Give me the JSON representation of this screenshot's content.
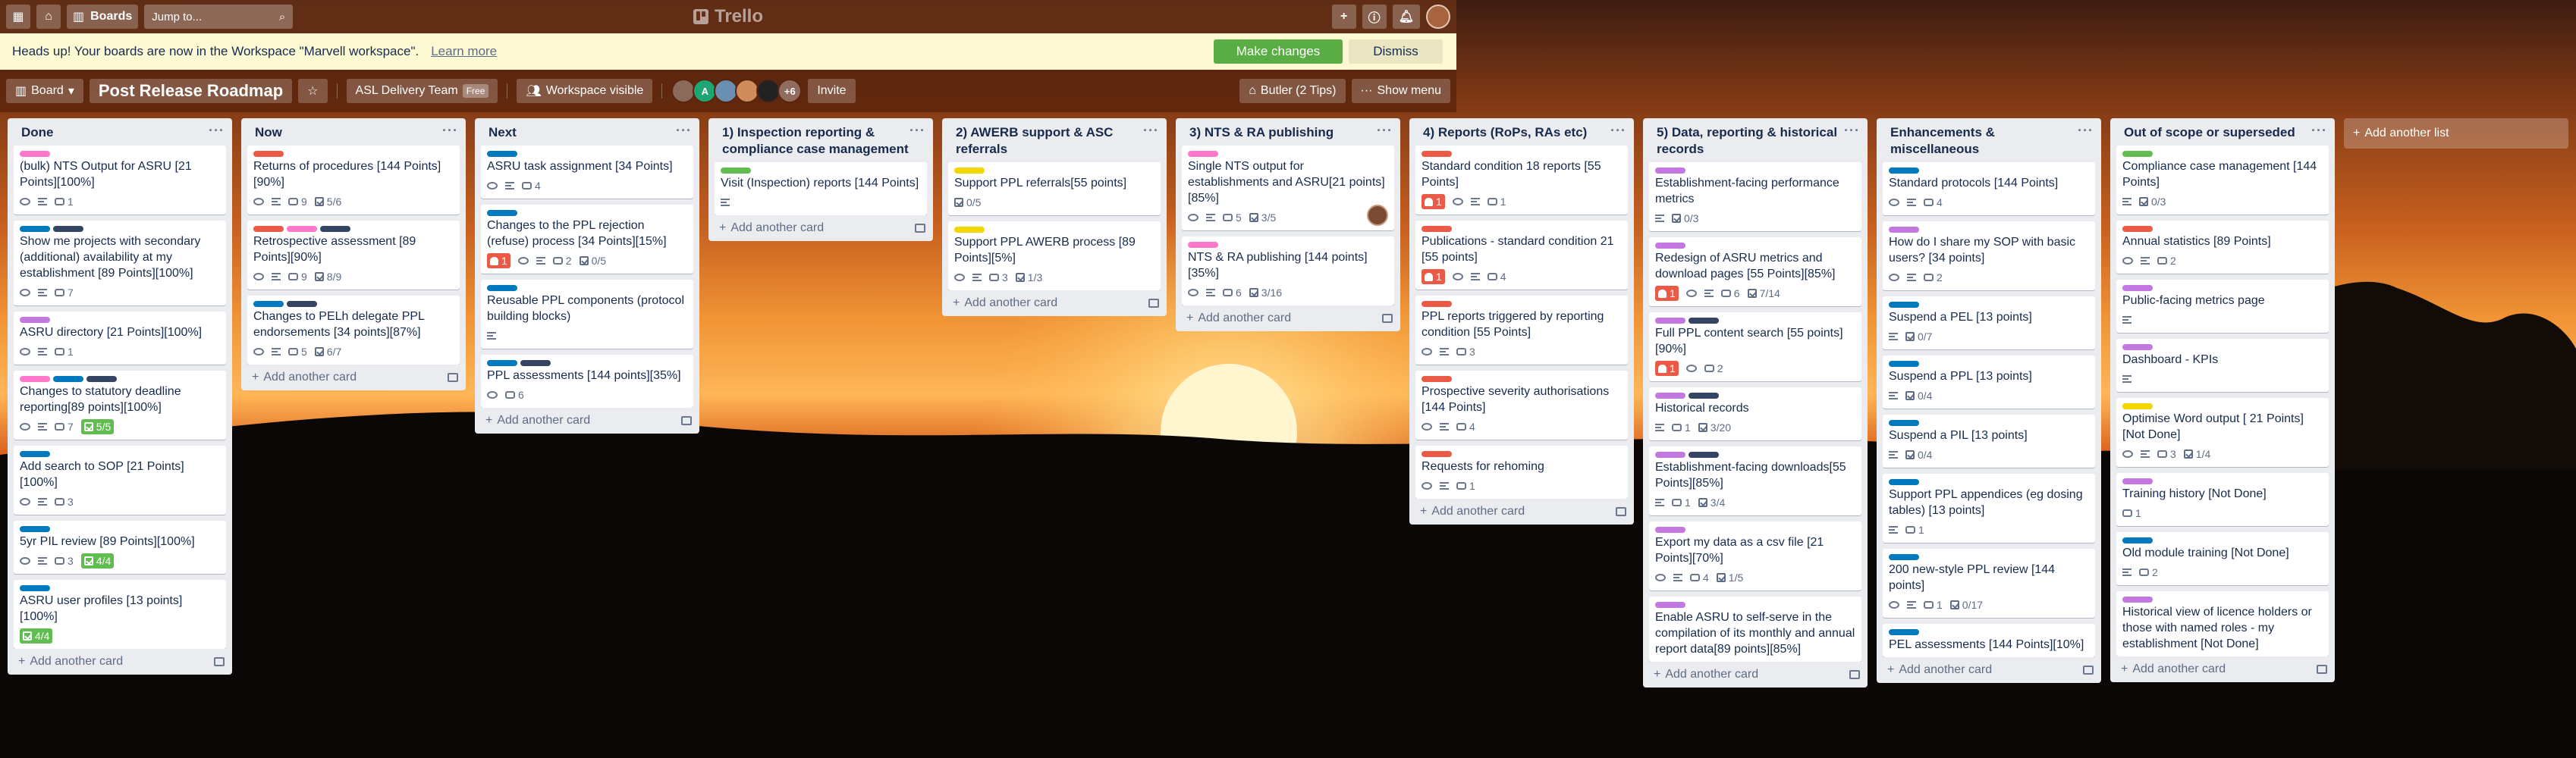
{
  "header": {
    "boards_label": "Boards",
    "search_placeholder": "Jump to...",
    "logo_text": "Trello"
  },
  "banner": {
    "message": "Heads up! Your boards are now in the Workspace \"Marvell workspace\".",
    "learn_more": "Learn more",
    "make_changes": "Make changes",
    "dismiss": "Dismiss"
  },
  "boardbar": {
    "view_label": "Board",
    "board_title": "Post Release Roadmap",
    "team_name": "ASL Delivery Team",
    "team_plan": "Free",
    "visibility": "Workspace visible",
    "extra_members": "+6",
    "invite": "Invite",
    "butler": "Butler (2 Tips)",
    "show_menu": "Show menu"
  },
  "add_card_label": "Add another card",
  "add_list_label": "Add another list",
  "label_colors": {
    "pink": "#ff78cb",
    "blue": "#0079bf",
    "navy": "#344563",
    "red": "#eb5a46",
    "green": "#61bd4f",
    "yellow": "#f2d600",
    "purple": "#c377e0",
    "sky": "#00c2e0"
  },
  "lists": [
    {
      "title": "Done",
      "cards": [
        {
          "title": "(bulk) NTS Output for ASRU [21 Points][100%]",
          "labels": [
            "pink"
          ],
          "badges": {
            "watch": true,
            "desc": true,
            "comments": "1"
          }
        },
        {
          "title": "Show me projects with secondary (additional) availability at my establishment [89 Points][100%]",
          "labels": [
            "blue",
            "navy"
          ],
          "badges": {
            "watch": true,
            "desc": true,
            "comments": "7"
          }
        },
        {
          "title": "ASRU directory [21 Points][100%]",
          "labels": [
            "purple"
          ],
          "badges": {
            "watch": true,
            "desc": true,
            "comments": "1"
          }
        },
        {
          "title": "Changes to statutory deadline reporting[89 points][100%]",
          "labels": [
            "pink",
            "blue",
            "navy"
          ],
          "badges": {
            "watch": true,
            "desc": true,
            "comments": "7",
            "checklist": "5/5",
            "checklist_done": true
          }
        },
        {
          "title": "Add search to SOP [21 Points][100%]",
          "labels": [
            "blue"
          ],
          "badges": {
            "watch": true,
            "desc": true,
            "comments": "3"
          }
        },
        {
          "title": "5yr PIL review [89 Points][100%]",
          "labels": [
            "blue"
          ],
          "badges": {
            "watch": true,
            "desc": true,
            "comments": "3",
            "checklist": "4/4",
            "checklist_done": true
          }
        },
        {
          "title": "ASRU user profiles [13 points][100%]",
          "labels": [
            "blue"
          ],
          "badges": {
            "checklist": "4/4",
            "checklist_done": true
          }
        }
      ]
    },
    {
      "title": "Now",
      "cards": [
        {
          "title": "Returns of procedures [144 Points][90%]",
          "labels": [
            "red"
          ],
          "badges": {
            "watch": true,
            "desc": true,
            "comments": "9",
            "checklist": "5/6"
          }
        },
        {
          "title": "Retrospective assessment [89 Points][90%]",
          "labels": [
            "red",
            "pink",
            "navy"
          ],
          "badges": {
            "watch": true,
            "desc": true,
            "comments": "9",
            "checklist": "8/9"
          }
        },
        {
          "title": "Changes to PELh delegate PPL endorsements [34 points][87%]",
          "labels": [
            "blue",
            "navy"
          ],
          "badges": {
            "watch": true,
            "desc": true,
            "comments": "5",
            "checklist": "6/7"
          }
        }
      ]
    },
    {
      "title": "Next",
      "cards": [
        {
          "title": "ASRU task assignment [34 Points]",
          "labels": [
            "blue"
          ],
          "badges": {
            "watch": true,
            "desc": true,
            "comments": "4"
          }
        },
        {
          "title": "Changes to the PPL rejection (refuse) process [34 Points][15%]",
          "labels": [
            "blue"
          ],
          "badges": {
            "due": "1",
            "watch": true,
            "desc": true,
            "comments": "2",
            "checklist": "0/5"
          }
        },
        {
          "title": "Reusable PPL components (protocol building blocks)",
          "labels": [
            "blue"
          ],
          "badges": {
            "desc": true
          }
        },
        {
          "title": "PPL assessments [144 points][35%]",
          "labels": [
            "blue",
            "navy"
          ],
          "badges": {
            "watch": true,
            "comments": "6"
          }
        }
      ]
    },
    {
      "title": "1) Inspection reporting & compliance case management",
      "cards": [
        {
          "title": "Visit (Inspection) reports [144 Points]",
          "labels": [
            "green"
          ],
          "badges": {
            "desc": true
          }
        }
      ]
    },
    {
      "title": "2) AWERB support & ASC referrals",
      "cards": [
        {
          "title": "Support PPL referrals[55 points]",
          "labels": [
            "yellow"
          ],
          "badges": {
            "checklist": "0/5"
          }
        },
        {
          "title": "Support PPL AWERB process [89 Points][5%]",
          "labels": [
            "yellow"
          ],
          "badges": {
            "watch": true,
            "desc": true,
            "comments": "3",
            "checklist": "1/3"
          }
        }
      ]
    },
    {
      "title": "3) NTS & RA publishing",
      "cards": [
        {
          "title": "Single NTS output for establishments and ASRU[21 points][85%]",
          "labels": [
            "pink"
          ],
          "badges": {
            "watch": true,
            "desc": true,
            "comments": "5",
            "checklist": "3/5"
          },
          "avatar": true
        },
        {
          "title": "NTS & RA publishing [144 points][35%]",
          "labels": [
            "pink"
          ],
          "badges": {
            "watch": true,
            "desc": true,
            "comments": "6",
            "checklist": "3/16"
          }
        }
      ]
    },
    {
      "title": "4) Reports (RoPs, RAs etc)",
      "cards": [
        {
          "title": "Standard condition 18 reports [55 Points]",
          "labels": [
            "red"
          ],
          "badges": {
            "due": "1",
            "watch": true,
            "desc": true,
            "comments": "1"
          }
        },
        {
          "title": "Publications - standard condition 21 [55 points]",
          "labels": [
            "red"
          ],
          "badges": {
            "due": "1",
            "watch": true,
            "desc": true,
            "comments": "4"
          }
        },
        {
          "title": "PPL reports triggered by reporting condition [55 Points]",
          "labels": [
            "red"
          ],
          "badges": {
            "watch": true,
            "desc": true,
            "comments": "3"
          }
        },
        {
          "title": "Prospective severity authorisations [144 Points]",
          "labels": [
            "red"
          ],
          "badges": {
            "watch": true,
            "desc": true,
            "comments": "4"
          }
        },
        {
          "title": "Requests for rehoming",
          "labels": [
            "red"
          ],
          "badges": {
            "watch": true,
            "desc": true,
            "comments": "1"
          }
        }
      ]
    },
    {
      "title": "5) Data, reporting & historical records",
      "cards": [
        {
          "title": "Establishment-facing performance metrics",
          "labels": [
            "purple"
          ],
          "badges": {
            "desc": true,
            "checklist": "0/3"
          }
        },
        {
          "title": "Redesign of ASRU metrics and download pages [55 Points][85%]",
          "labels": [
            "purple"
          ],
          "badges": {
            "due": "1",
            "watch": true,
            "desc": true,
            "comments": "6",
            "checklist": "7/14"
          }
        },
        {
          "title": "Full PPL content search [55 points][90%]",
          "labels": [
            "purple",
            "navy"
          ],
          "badges": {
            "due": "1",
            "watch": true,
            "comments": "2"
          }
        },
        {
          "title": "Historical records",
          "labels": [
            "purple",
            "navy"
          ],
          "badges": {
            "desc": true,
            "comments": "1",
            "checklist": "3/20"
          }
        },
        {
          "title": "Establishment-facing downloads[55 Points][85%]",
          "labels": [
            "purple",
            "navy"
          ],
          "badges": {
            "desc": true,
            "comments": "1",
            "checklist": "3/4"
          }
        },
        {
          "title": "Export my data as a csv file [21 Points][70%]",
          "labels": [
            "purple"
          ],
          "badges": {
            "watch": true,
            "desc": true,
            "comments": "4",
            "checklist": "1/5"
          }
        },
        {
          "title": "Enable ASRU to self-serve in the compilation of its monthly and annual report data[89 points][85%]",
          "labels": [
            "purple"
          ],
          "badges": {}
        }
      ]
    },
    {
      "title": "Enhancements & miscellaneous",
      "cards": [
        {
          "title": "Standard protocols [144 Points]",
          "labels": [
            "blue"
          ],
          "badges": {
            "watch": true,
            "desc": true,
            "comments": "4"
          }
        },
        {
          "title": "How do I share my SOP with basic users? [34 points]",
          "labels": [
            "purple"
          ],
          "badges": {
            "watch": true,
            "desc": true,
            "comments": "2"
          }
        },
        {
          "title": "Suspend a PEL [13 points]",
          "labels": [
            "blue"
          ],
          "badges": {
            "desc": true,
            "checklist": "0/7"
          }
        },
        {
          "title": "Suspend a PPL [13 points]",
          "labels": [
            "blue"
          ],
          "badges": {
            "desc": true,
            "checklist": "0/4"
          }
        },
        {
          "title": "Suspend a PIL [13 points]",
          "labels": [
            "blue"
          ],
          "badges": {
            "desc": true,
            "checklist": "0/4"
          }
        },
        {
          "title": "Support PPL appendices (eg dosing tables) [13 points]",
          "labels": [
            "blue"
          ],
          "badges": {
            "desc": true,
            "comments": "1"
          }
        },
        {
          "title": "200 new-style PPL review [144 points]",
          "labels": [
            "blue"
          ],
          "badges": {
            "watch": true,
            "desc": true,
            "comments": "1",
            "checklist": "0/17"
          }
        },
        {
          "title": "PEL assessments [144 Points][10%]",
          "labels": [
            "blue"
          ],
          "badges": {}
        }
      ]
    },
    {
      "title": "Out of scope or superseded",
      "cards": [
        {
          "title": "Compliance case management [144 Points]",
          "labels": [
            "green"
          ],
          "badges": {
            "desc": true,
            "checklist": "0/3"
          }
        },
        {
          "title": "Annual statistics [89 Points]",
          "labels": [
            "red"
          ],
          "badges": {
            "watch": true,
            "desc": true,
            "comments": "2"
          }
        },
        {
          "title": "Public-facing metrics page",
          "labels": [
            "purple"
          ],
          "badges": {
            "desc": true
          }
        },
        {
          "title": "Dashboard - KPIs",
          "labels": [
            "purple"
          ],
          "badges": {
            "desc": true
          }
        },
        {
          "title": "Optimise Word output [ 21 Points] [Not Done]",
          "labels": [
            "yellow"
          ],
          "badges": {
            "watch": true,
            "desc": true,
            "comments": "3",
            "checklist": "1/4"
          }
        },
        {
          "title": "Training history [Not Done]",
          "labels": [
            "purple"
          ],
          "badges": {
            "comments": "1"
          }
        },
        {
          "title": "Old module training [Not Done]",
          "labels": [
            "blue"
          ],
          "badges": {
            "desc": true,
            "comments": "2"
          }
        },
        {
          "title": "Historical view of licence holders or those with named roles - my establishment [Not Done]",
          "labels": [
            "purple"
          ],
          "badges": {}
        }
      ]
    }
  ]
}
